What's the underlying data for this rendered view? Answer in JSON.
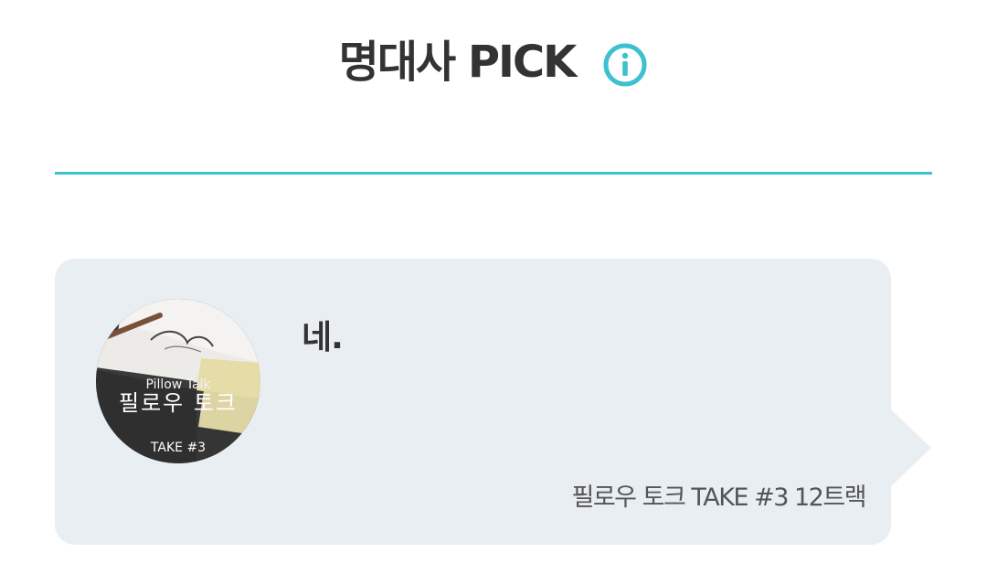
{
  "header": {
    "title": "명대사 PICK",
    "info_icon": "info-icon",
    "accent_color": "#3cc1cf"
  },
  "quote_card": {
    "quote_text": "네.",
    "source_text": "필로우 토크 TAKE #3 12트랙",
    "background_color": "#e9eef3",
    "album": {
      "subtitle": "Pillow Talk",
      "title": "필로우 토크",
      "take": "TAKE #3"
    }
  }
}
